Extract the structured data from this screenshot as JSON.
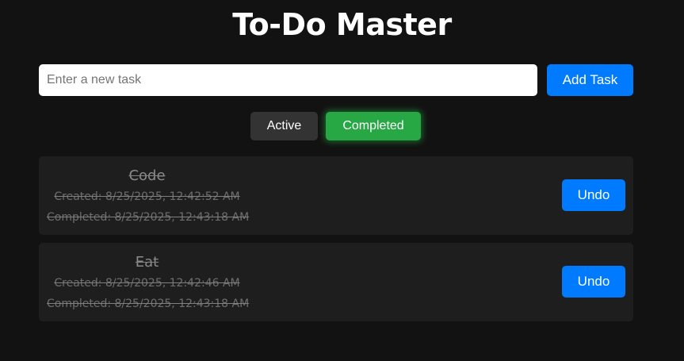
{
  "app": {
    "title": "To-Do Master"
  },
  "input": {
    "placeholder": "Enter a new task",
    "value": ""
  },
  "add_button": {
    "label": "Add Task"
  },
  "filters": {
    "active_label": "Active",
    "completed_label": "Completed",
    "selected": "Completed"
  },
  "tasks": [
    {
      "name": "Code",
      "created": "Created: 8/25/2025, 12:42:52 AM",
      "completed": "Completed: 8/25/2025, 12:43:18 AM",
      "action_label": "Undo"
    },
    {
      "name": "Eat",
      "created": "Created: 8/25/2025, 12:42:46 AM",
      "completed": "Completed: 8/25/2025, 12:43:18 AM",
      "action_label": "Undo"
    }
  ],
  "colors": {
    "background": "#121212",
    "card": "#1e1e1e",
    "primary": "#007bff",
    "success": "#28a745",
    "neutral": "#333333"
  }
}
